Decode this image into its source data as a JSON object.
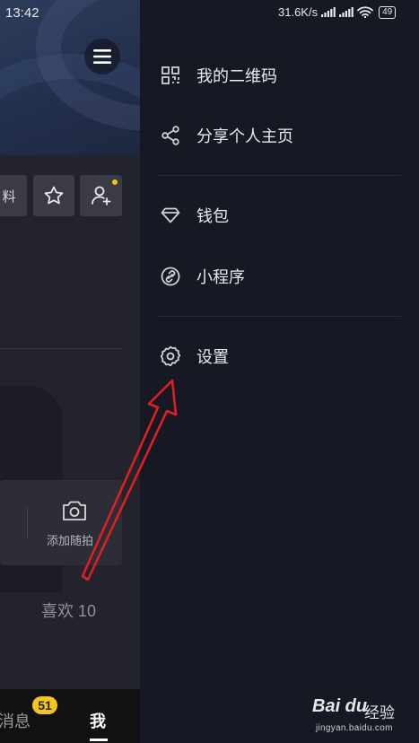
{
  "status_bar": {
    "time": "13:42",
    "network_speed": "31.6K/s",
    "battery": "49"
  },
  "profile": {
    "edit_fragment": "料",
    "add_moment_label": "添加随拍",
    "likes_label": "喜欢 10"
  },
  "bottom_nav": {
    "messages_label": "消息",
    "messages_badge": "51",
    "me_label": "我"
  },
  "drawer": {
    "items": [
      {
        "label": "我的二维码",
        "icon": "qr-code-icon"
      },
      {
        "label": "分享个人主页",
        "icon": "share-icon"
      },
      {
        "label": "钱包",
        "icon": "diamond-wallet-icon"
      },
      {
        "label": "小程序",
        "icon": "link-mini-program-icon"
      },
      {
        "label": "设置",
        "icon": "gear-icon"
      }
    ]
  },
  "annotation": {
    "arrow_color": "#e02020",
    "target": "设置"
  },
  "watermark": {
    "logo": "Bai du",
    "text": "经验",
    "url": "jingyan.baidu.com"
  }
}
